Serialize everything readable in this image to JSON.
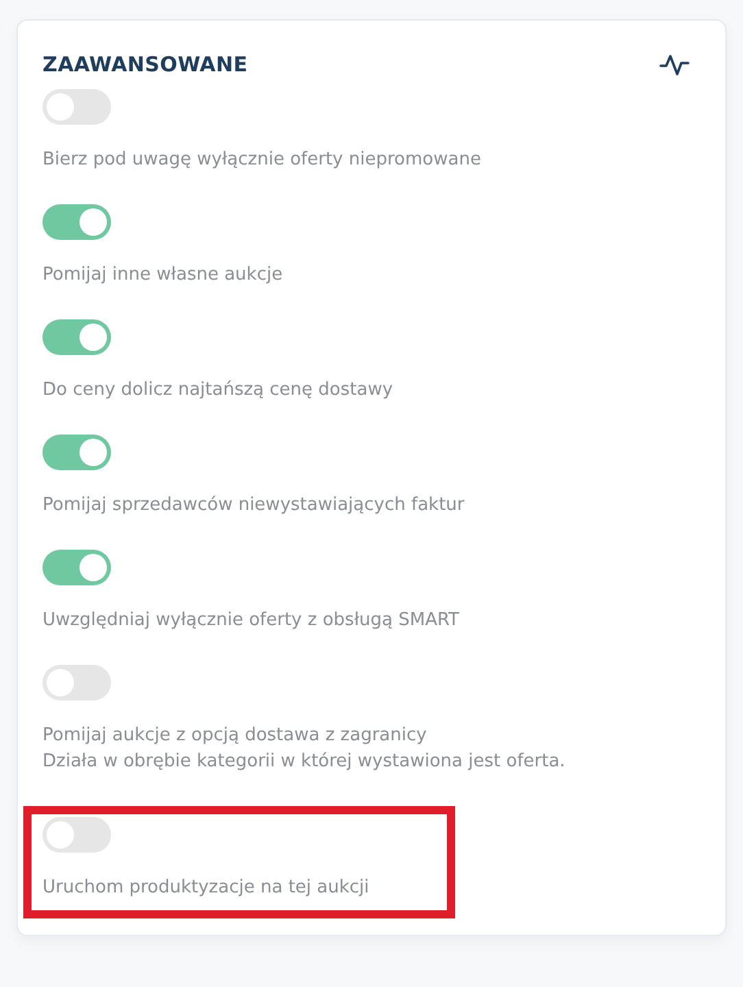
{
  "panel": {
    "title": "ZAAWANSOWANE",
    "options": [
      {
        "label": "Bierz pod uwagę wyłącznie oferty niepromowane",
        "on": false,
        "highlighted": false
      },
      {
        "label": "Pomijaj inne własne aukcje",
        "on": true,
        "highlighted": false
      },
      {
        "label": "Do ceny dolicz najtańszą cenę dostawy",
        "on": true,
        "highlighted": false
      },
      {
        "label": "Pomijaj sprzedawców niewystawiających faktur",
        "on": true,
        "highlighted": false
      },
      {
        "label": "Uwzględniaj wyłącznie oferty z obsługą SMART",
        "on": true,
        "highlighted": false
      },
      {
        "label": "Pomijaj aukcje z opcją dostawa z zagranicy",
        "note": "Działa w obrębie kategorii w której wystawiona jest oferta.",
        "on": false,
        "highlighted": false
      },
      {
        "label": "Uruchom produktyzacje na tej aukcji",
        "on": false,
        "highlighted": true
      }
    ]
  }
}
